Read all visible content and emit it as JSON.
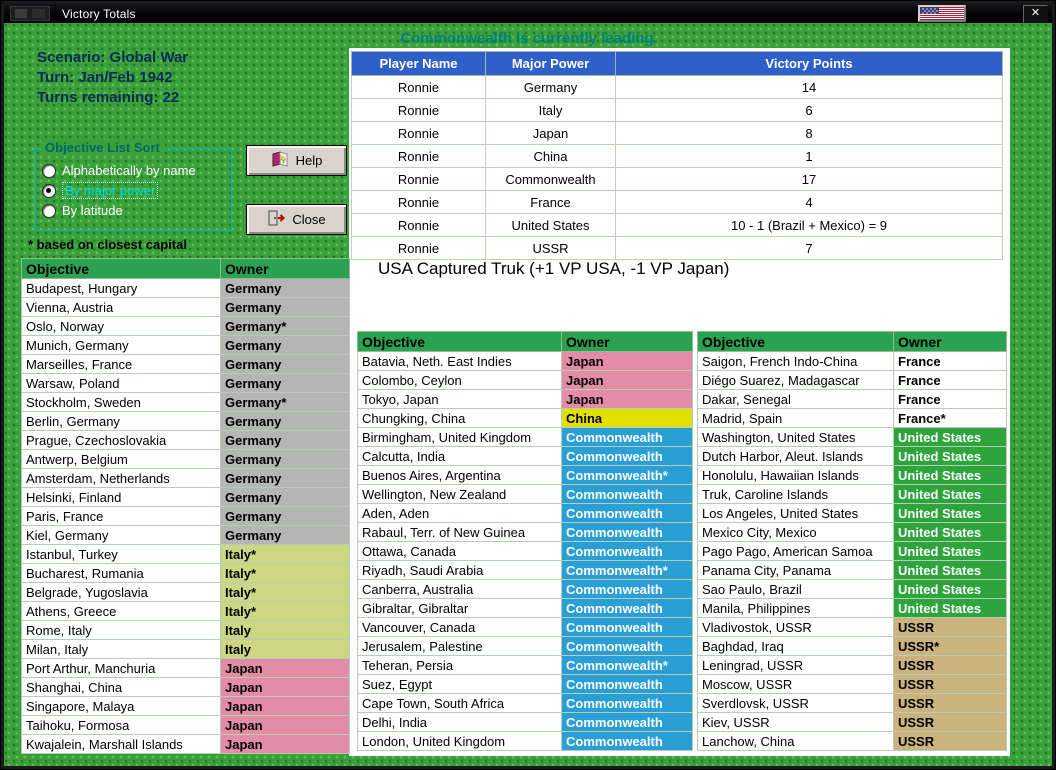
{
  "window": {
    "title": "Victory Totals",
    "close_glyph": "✕"
  },
  "icons": {
    "app_icon": "game-logo",
    "flag_icon": "us-flag",
    "close_icon": "close-x",
    "help_icon": "help-book",
    "exit_icon": "exit-door"
  },
  "status": {
    "text": "Commonwealth is currently leading.",
    "color": "#008080"
  },
  "scenario": {
    "name": "Scenario: Global War",
    "turn": "Turn: Jan/Feb 1942",
    "turns_remaining": "Turns remaining: 22"
  },
  "sort_box": {
    "title": "Objective List Sort",
    "options": [
      {
        "label": "Alphabetically by name",
        "selected": false
      },
      {
        "label": "By major power",
        "selected": true
      },
      {
        "label": "By latitude",
        "selected": false
      }
    ]
  },
  "buttons": {
    "help": "Help",
    "close": "Close"
  },
  "footnote": "* based on closest capital",
  "vp_table": {
    "headers": [
      "Player Name",
      "Major Power",
      "Victory Points"
    ],
    "rows": [
      [
        "Ronnie",
        "Germany",
        "14"
      ],
      [
        "Ronnie",
        "Italy",
        "6"
      ],
      [
        "Ronnie",
        "Japan",
        "8"
      ],
      [
        "Ronnie",
        "China",
        "1"
      ],
      [
        "Ronnie",
        "Commonwealth",
        "17"
      ],
      [
        "Ronnie",
        "France",
        "4"
      ],
      [
        "Ronnie",
        "United States",
        "10 - 1 (Brazil + Mexico) = 9"
      ],
      [
        "Ronnie",
        "USSR",
        "7"
      ]
    ]
  },
  "message": "USA Captured Truk (+1 VP USA, -1 VP Japan)",
  "objectives": {
    "headers": [
      "Objective",
      "Owner"
    ],
    "left": [
      [
        "Budapest, Hungary",
        "Germany"
      ],
      [
        "Vienna, Austria",
        "Germany"
      ],
      [
        "Oslo, Norway",
        "Germany*"
      ],
      [
        "Munich, Germany",
        "Germany"
      ],
      [
        "Marseilles, France",
        "Germany"
      ],
      [
        "Warsaw, Poland",
        "Germany"
      ],
      [
        "Stockholm, Sweden",
        "Germany*"
      ],
      [
        "Berlin, Germany",
        "Germany"
      ],
      [
        "Prague, Czechoslovakia",
        "Germany"
      ],
      [
        "Antwerp, Belgium",
        "Germany"
      ],
      [
        "Amsterdam, Netherlands",
        "Germany"
      ],
      [
        "Helsinki, Finland",
        "Germany"
      ],
      [
        "Paris, France",
        "Germany"
      ],
      [
        "Kiel, Germany",
        "Germany"
      ],
      [
        "Istanbul, Turkey",
        "Italy*"
      ],
      [
        "Bucharest, Rumania",
        "Italy*"
      ],
      [
        "Belgrade, Yugoslavia",
        "Italy*"
      ],
      [
        "Athens, Greece",
        "Italy*"
      ],
      [
        "Rome, Italy",
        "Italy"
      ],
      [
        "Milan, Italy",
        "Italy"
      ],
      [
        "Port Arthur, Manchuria",
        "Japan"
      ],
      [
        "Shanghai, China",
        "Japan"
      ],
      [
        "Singapore, Malaya",
        "Japan"
      ],
      [
        "Taihoku, Formosa",
        "Japan"
      ],
      [
        "Kwajalein, Marshall Islands",
        "Japan"
      ]
    ],
    "middle": [
      [
        "Batavia, Neth. East Indies",
        "Japan"
      ],
      [
        "Colombo, Ceylon",
        "Japan"
      ],
      [
        "Tokyo, Japan",
        "Japan"
      ],
      [
        "Chungking, China",
        "China"
      ],
      [
        "Birmingham, United Kingdom",
        "Commonwealth"
      ],
      [
        "Calcutta, India",
        "Commonwealth"
      ],
      [
        "Buenos Aires, Argentina",
        "Commonwealth*"
      ],
      [
        "Wellington, New Zealand",
        "Commonwealth"
      ],
      [
        "Aden, Aden",
        "Commonwealth"
      ],
      [
        "Rabaul, Terr. of New Guinea",
        "Commonwealth"
      ],
      [
        "Ottawa, Canada",
        "Commonwealth"
      ],
      [
        "Riyadh, Saudi Arabia",
        "Commonwealth*"
      ],
      [
        "Canberra, Australia",
        "Commonwealth"
      ],
      [
        "Gibraltar, Gibraltar",
        "Commonwealth"
      ],
      [
        "Vancouver, Canada",
        "Commonwealth"
      ],
      [
        "Jerusalem, Palestine",
        "Commonwealth"
      ],
      [
        "Teheran, Persia",
        "Commonwealth*"
      ],
      [
        "Suez, Egypt",
        "Commonwealth"
      ],
      [
        "Cape Town, South Africa",
        "Commonwealth"
      ],
      [
        "Delhi, India",
        "Commonwealth"
      ],
      [
        "London, United Kingdom",
        "Commonwealth"
      ]
    ],
    "right": [
      [
        "Saigon, French Indo-China",
        "France"
      ],
      [
        "Diégo Suarez, Madagascar",
        "France"
      ],
      [
        "Dakar, Senegal",
        "France"
      ],
      [
        "Madrid, Spain",
        "France*"
      ],
      [
        "Washington, United States",
        "United States"
      ],
      [
        "Dutch Harbor, Aleut. Islands",
        "United States"
      ],
      [
        "Honolulu, Hawaiian Islands",
        "United States"
      ],
      [
        "Truk, Caroline Islands",
        "United States"
      ],
      [
        "Los Angeles, United States",
        "United States"
      ],
      [
        "Mexico City, Mexico",
        "United States"
      ],
      [
        "Pago Pago, American Samoa",
        "United States"
      ],
      [
        "Panama City, Panama",
        "United States"
      ],
      [
        "Sao Paulo, Brazil",
        "United States"
      ],
      [
        "Manila, Philippines",
        "United States"
      ],
      [
        "Vladivostok, USSR",
        "USSR"
      ],
      [
        "Baghdad, Iraq",
        "USSR*"
      ],
      [
        "Leningrad, USSR",
        "USSR"
      ],
      [
        "Moscow, USSR",
        "USSR"
      ],
      [
        "Sverdlovsk, USSR",
        "USSR"
      ],
      [
        "Kiev, USSR",
        "USSR"
      ],
      [
        "Lanchow, China",
        "USSR"
      ]
    ]
  },
  "owner_colors": {
    "Germany": {
      "bg": "#b5b5b5",
      "fg": "#000000"
    },
    "Italy": {
      "bg": "#ccd784",
      "fg": "#000000"
    },
    "Japan": {
      "bg": "#e28ca9",
      "fg": "#000000"
    },
    "China": {
      "bg": "#e3df00",
      "fg": "#000000"
    },
    "Commonwealth": {
      "bg": "#2a9fd6",
      "fg": "#ffffff"
    },
    "France": {
      "bg": "#ffffff",
      "fg": "#000000"
    },
    "United States": {
      "bg": "#2ea43c",
      "fg": "#ffffff"
    },
    "USSR": {
      "bg": "#cab37d",
      "fg": "#000000"
    }
  }
}
